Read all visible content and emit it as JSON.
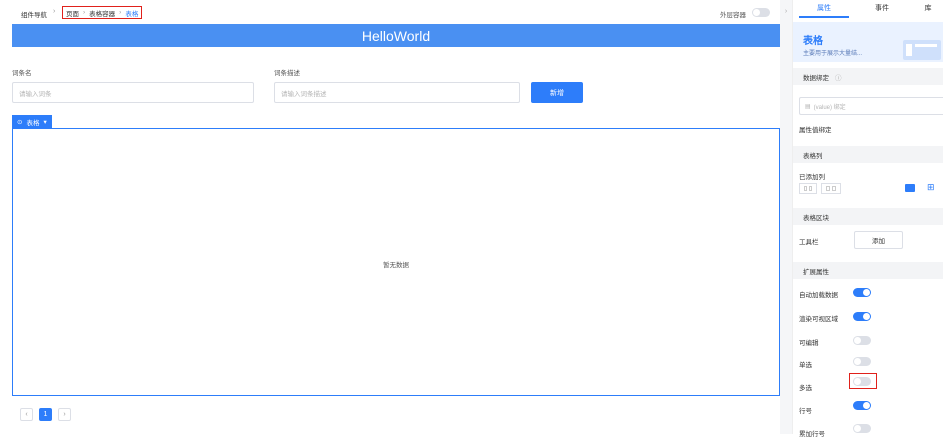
{
  "topbar": {
    "nav_label": "组件导航",
    "crumbs": [
      "页面",
      "表格容器",
      "表格"
    ],
    "outer_container_label": "外层容器"
  },
  "banner": {
    "title": "HelloWorld"
  },
  "form": {
    "field1_label": "词条名",
    "field1_placeholder": "请输入词条",
    "field2_label": "词条描述",
    "field2_placeholder": "请输入词条描述",
    "add_button": "新增"
  },
  "table": {
    "tag_label": "表格",
    "empty_text": "暂无数据"
  },
  "pagination": {
    "current_page": "1"
  },
  "panel": {
    "tabs": [
      "属性",
      "事件",
      "库"
    ],
    "card_title": "表格",
    "card_desc": "主要用于展示大量结...",
    "data_binding_title": "数据绑定",
    "value_binding_placeholder": "(value) 绑定",
    "attr_value_binding": "属性值绑定",
    "table_columns_title": "表格列",
    "added_columns": "已添加列",
    "table_block_title": "表格区块",
    "toolbar_label": "工具栏",
    "toolbar_add": "添加",
    "ext_props_title": "扩展属性",
    "props": [
      {
        "label": "自动加载数据",
        "on": true
      },
      {
        "label": "渲染可视区域",
        "on": true
      },
      {
        "label": "可编辑",
        "on": false
      },
      {
        "label": "单选",
        "on": false
      },
      {
        "label": "多选",
        "on": false
      },
      {
        "label": "行号",
        "on": true
      },
      {
        "label": "累加行号",
        "on": false
      }
    ]
  },
  "colors": {
    "accent": "#2d7dfa",
    "banner": "#4a90f2",
    "highlight": "#e0211b"
  }
}
